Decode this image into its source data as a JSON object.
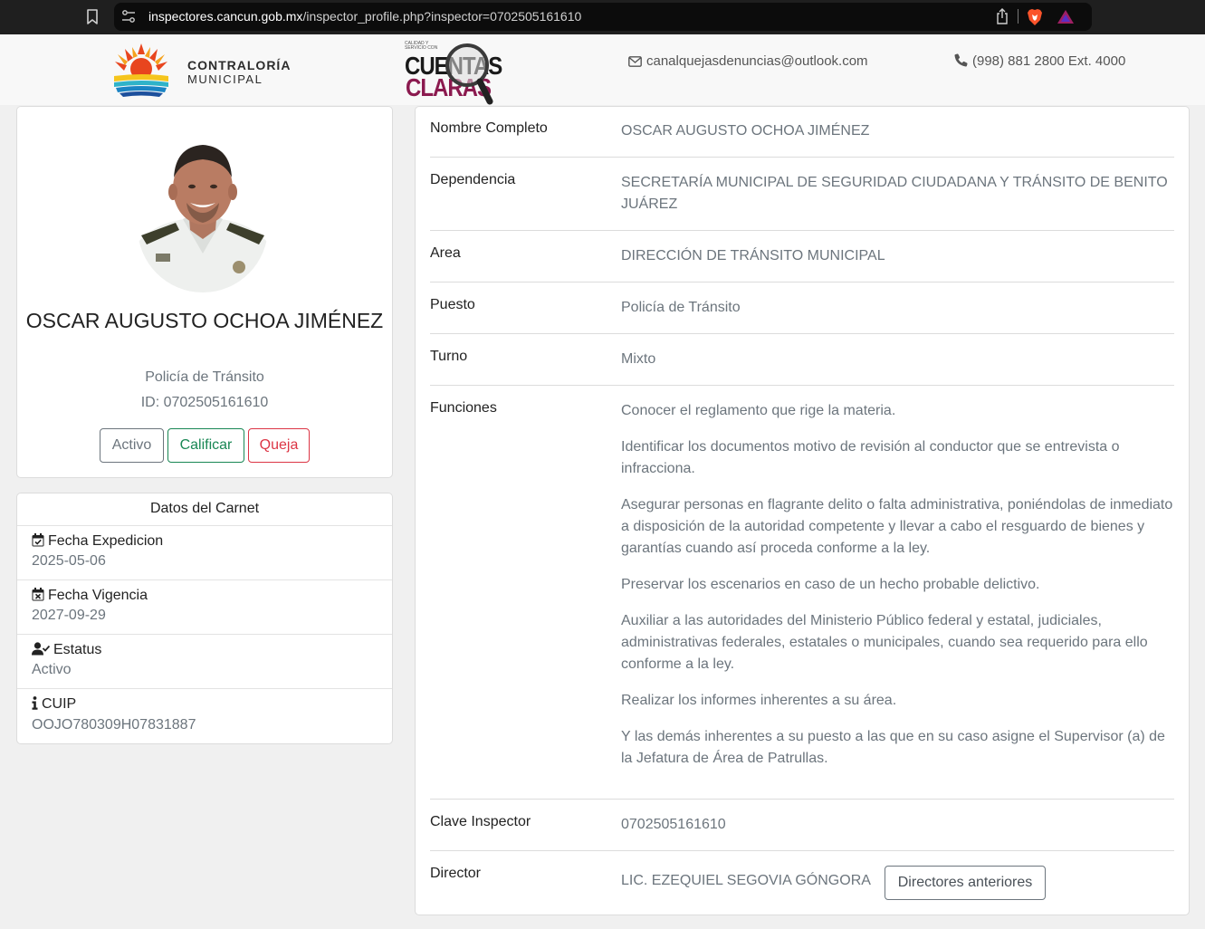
{
  "browser": {
    "url_host": "inspectores.cancun.gob.mx",
    "url_path": "/inspector_profile.php?inspector=0702505161610"
  },
  "header": {
    "logo_line1": "CONTRALORÍA",
    "logo_line2": "MUNICIPAL",
    "cc_small": "CALIDAD Y SERVICIO CON",
    "cc_line1": "CUENTAS",
    "cc_line2": "CLARAS",
    "email": "canalquejasdenuncias@outlook.com",
    "phone": "(998) 881 2800 Ext. 4000"
  },
  "profile": {
    "name": "OSCAR AUGUSTO OCHOA JIMÉNEZ",
    "puesto": "Policía de Tránsito",
    "id_text": "ID: 0702505161610",
    "buttons": {
      "activo": "Activo",
      "calificar": "Calificar",
      "queja": "Queja"
    }
  },
  "carnet": {
    "title": "Datos del Carnet",
    "fields": [
      {
        "label": "Fecha Expedicion",
        "value": "2025-05-06",
        "icon": "calendar-check-icon"
      },
      {
        "label": "Fecha Vigencia",
        "value": "2027-09-29",
        "icon": "calendar-x-icon"
      },
      {
        "label": "Estatus",
        "value": "Activo",
        "icon": "user-check-icon"
      },
      {
        "label": "CUIP",
        "value": "OOJO780309H07831887",
        "icon": "info-icon"
      }
    ]
  },
  "details": {
    "nombre_label": "Nombre Completo",
    "nombre_value": "OSCAR AUGUSTO OCHOA JIMÉNEZ",
    "dependencia_label": "Dependencia",
    "dependencia_value": "SECRETARÍA MUNICIPAL DE SEGURIDAD CIUDADANA Y TRÁNSITO DE BENITO JUÁREZ",
    "area_label": "Area",
    "area_value": "DIRECCIÓN DE TRÁNSITO MUNICIPAL",
    "puesto_label": "Puesto",
    "puesto_value": "Policía de Tránsito",
    "turno_label": "Turno",
    "turno_value": "Mixto",
    "funciones_label": "Funciones",
    "funciones": [
      "Conocer el reglamento que rige la materia.",
      "Identificar los documentos motivo de revisión al conductor que se entrevista o infracciona.",
      "Asegurar personas en flagrante delito o falta administrativa, poniéndolas de inmediato a disposición de la autoridad competente y llevar a cabo el resguardo de bienes y garantías cuando así proceda conforme a la ley.",
      "Preservar los escenarios en caso de un hecho probable delictivo.",
      "Auxiliar a las autoridades del Ministerio Público federal y estatal, judiciales, administrativas federales, estatales o municipales, cuando sea requerido para ello conforme a la ley.",
      "Realizar los informes inherentes a su área.",
      "Y las demás inherentes a su puesto a las que en su caso asigne el Supervisor (a) de la Jefatura de Área de Patrullas."
    ],
    "clave_label": "Clave Inspector",
    "clave_value": "0702505161610",
    "director_label": "Director",
    "director_value": "LIC. EZEQUIEL SEGOVIA GÓNGORA",
    "directores_button": "Directores anteriores"
  },
  "colors": {
    "success": "#198754",
    "danger": "#dc3545",
    "secondary": "#6c757d",
    "cc_brand": "#8b1a4f"
  }
}
